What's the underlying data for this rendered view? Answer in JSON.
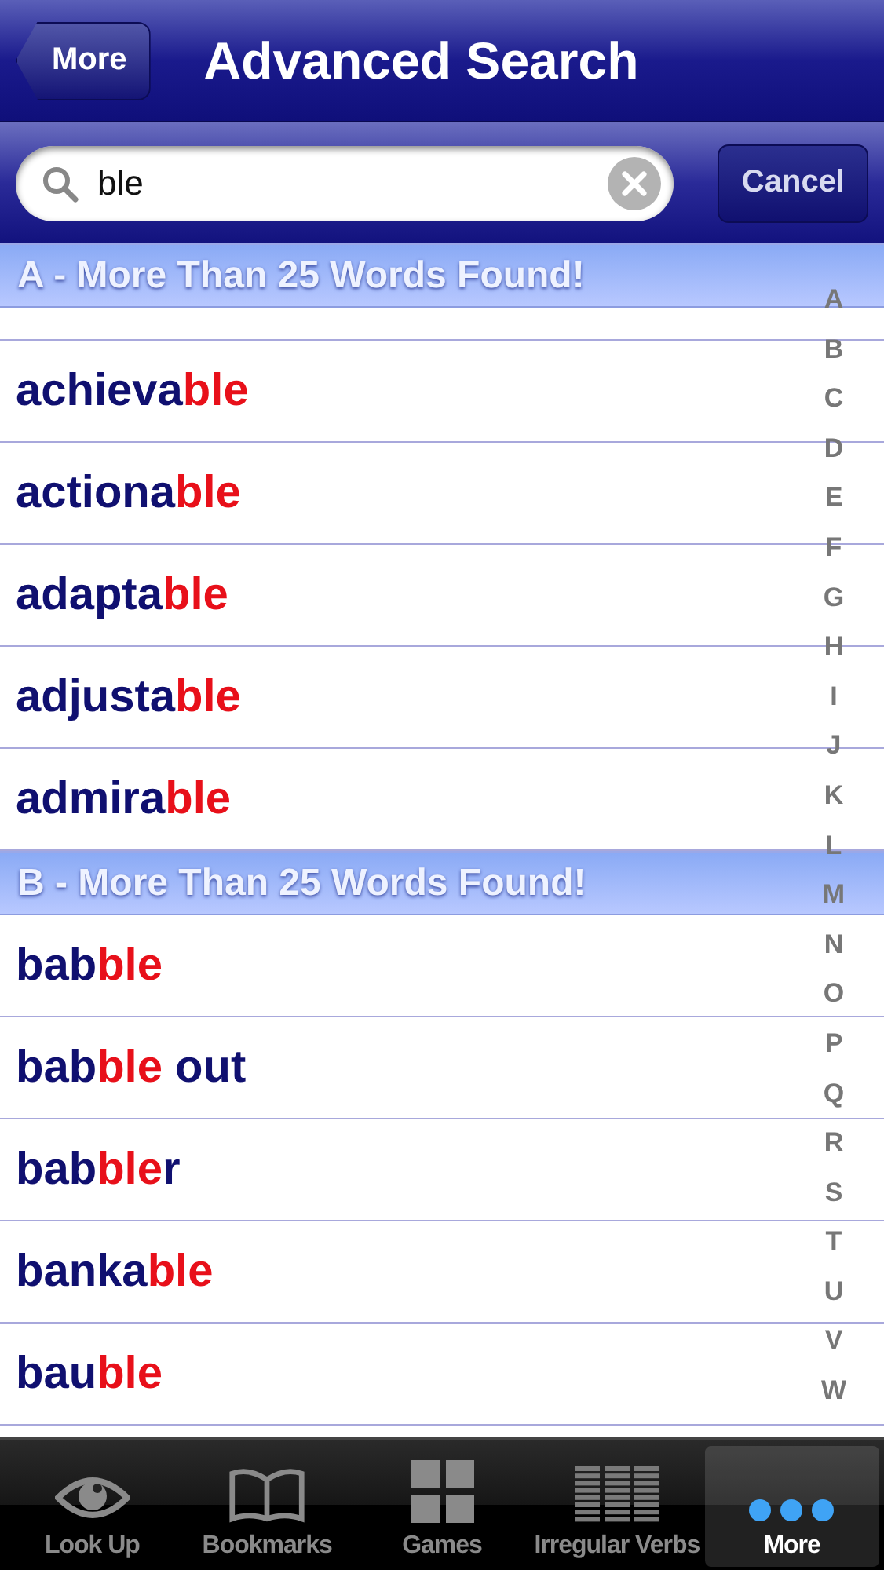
{
  "nav_bar": {
    "back_button": "More",
    "title": "Advanced Search"
  },
  "search": {
    "value": "ble",
    "cancel": "Cancel"
  },
  "sections": [
    {
      "header": "A - More Than 25 Words Found!",
      "rows": [
        {
          "before": "achieva",
          "match": "ble",
          "after": ""
        },
        {
          "before": "actiona",
          "match": "ble",
          "after": ""
        },
        {
          "before": "adapta",
          "match": "ble",
          "after": ""
        },
        {
          "before": "adjusta",
          "match": "ble",
          "after": ""
        },
        {
          "before": "admira",
          "match": "ble",
          "after": ""
        }
      ]
    },
    {
      "header": "B - More Than 25 Words Found!",
      "rows": [
        {
          "before": "bab",
          "match": "ble",
          "after": ""
        },
        {
          "before": "bab",
          "match": "ble",
          "after": " out"
        },
        {
          "before": "bab",
          "match": "ble",
          "after": "r"
        },
        {
          "before": "banka",
          "match": "ble",
          "after": ""
        },
        {
          "before": "bau",
          "match": "ble",
          "after": ""
        }
      ]
    }
  ],
  "index": [
    "A",
    "B",
    "C",
    "D",
    "E",
    "F",
    "G",
    "H",
    "I",
    "J",
    "K",
    "L",
    "M",
    "N",
    "O",
    "P",
    "Q",
    "R",
    "S",
    "T",
    "U",
    "V",
    "W"
  ],
  "tabs": [
    {
      "kind": "eye",
      "label": "Look Up",
      "selected": false
    },
    {
      "kind": "book",
      "label": "Bookmarks",
      "selected": false
    },
    {
      "kind": "grid",
      "label": "Games",
      "selected": false
    },
    {
      "kind": "lines",
      "label": "Irregular Verbs",
      "selected": false
    },
    {
      "kind": "dots",
      "label": "More",
      "selected": true
    }
  ]
}
